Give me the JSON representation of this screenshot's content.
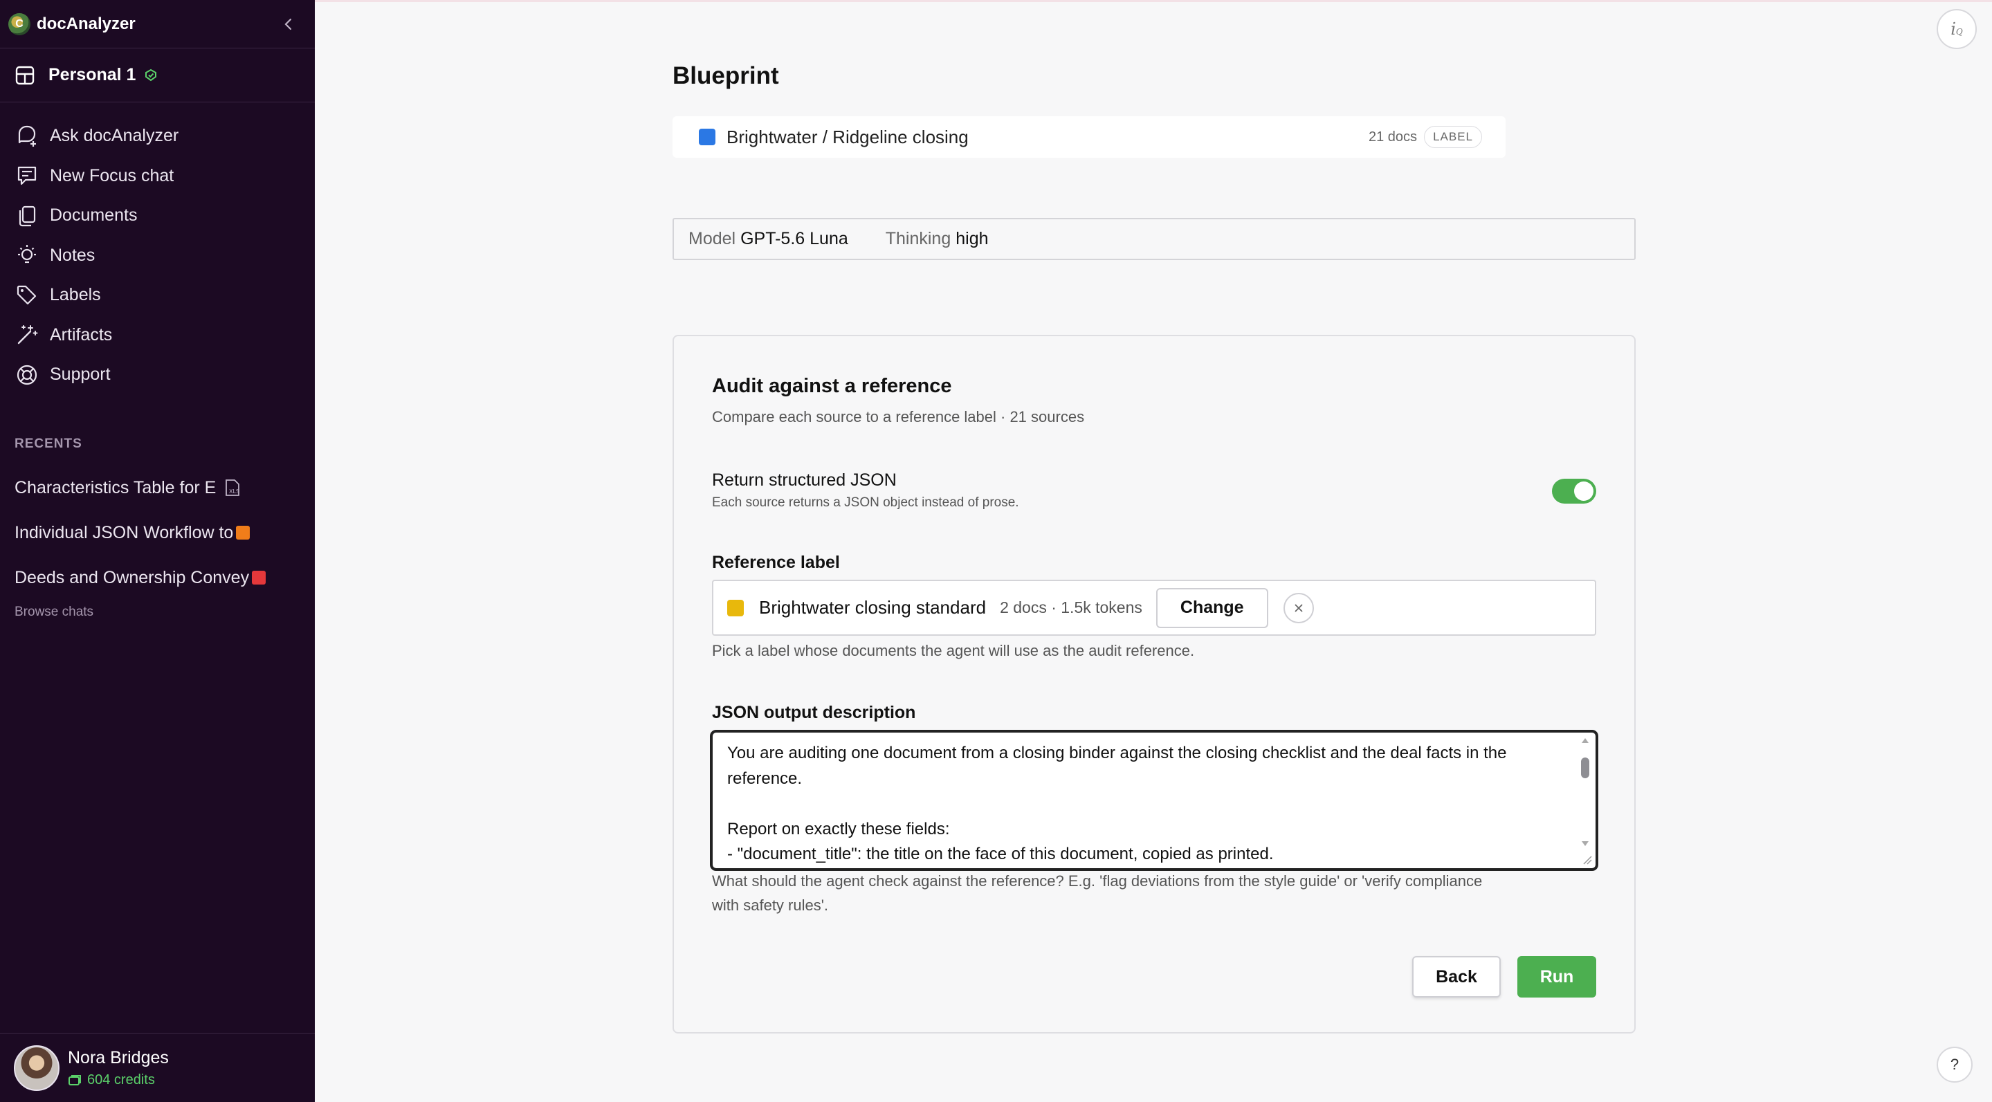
{
  "app": {
    "name": "docAnalyzer"
  },
  "workspace": {
    "name": "Personal 1"
  },
  "nav": [
    {
      "label": "Ask docAnalyzer",
      "icon": "chat-plus-icon"
    },
    {
      "label": "New Focus chat",
      "icon": "focus-chat-icon"
    },
    {
      "label": "Documents",
      "icon": "documents-icon"
    },
    {
      "label": "Notes",
      "icon": "lightbulb-icon"
    },
    {
      "label": "Labels",
      "icon": "tag-icon"
    },
    {
      "label": "Artifacts",
      "icon": "magic-wand-icon"
    },
    {
      "label": "Support",
      "icon": "lifebuoy-icon"
    }
  ],
  "recents": {
    "title": "RECENTS",
    "items": [
      {
        "label": "Characteristics Table for E",
        "chip_color": ""
      },
      {
        "label": "Individual JSON Workflow to",
        "chip_color": "#f07d1a"
      },
      {
        "label": "Deeds and Ownership Convey",
        "chip_color": "#e5383b"
      }
    ],
    "browse": "Browse chats"
  },
  "user": {
    "name": "Nora Bridges",
    "credits": "604 credits"
  },
  "page": {
    "title": "Blueprint"
  },
  "blueprint": {
    "name": "Brightwater / Ridgeline closing",
    "docs": "21 docs",
    "tag": "LABEL",
    "chip_color": "#2b78e4"
  },
  "model": {
    "model_key": "Model",
    "model_value": "GPT-5.6 Luna",
    "thinking_key": "Thinking",
    "thinking_value": "high"
  },
  "card": {
    "title": "Audit against a reference",
    "subtitle": "Compare each source to a reference label · 21 sources",
    "json_toggle": {
      "label": "Return structured JSON",
      "description": "Each source returns a JSON object instead of prose.",
      "on": true
    },
    "reference": {
      "title": "Reference label",
      "name": "Brightwater closing standard",
      "meta": "2 docs · 1.5k tokens",
      "change_label": "Change",
      "hint": "Pick a label whose documents the agent will use as the audit reference.",
      "chip_color": "#e8b80c"
    },
    "json_output": {
      "title": "JSON output description",
      "value": "You are auditing one document from a closing binder against the closing checklist and the deal facts in the reference.\n\nReport on exactly these fields:\n- \"document_title\": the title on the face of this document, copied as printed.",
      "hint": "What should the agent check against the reference? E.g. 'flag deviations from the style guide' or 'verify compliance with safety rules'."
    },
    "back_label": "Back",
    "run_label": "Run"
  },
  "colors": {
    "sidebar_bg": "#1c0a23",
    "accent_green": "#4caf50"
  }
}
